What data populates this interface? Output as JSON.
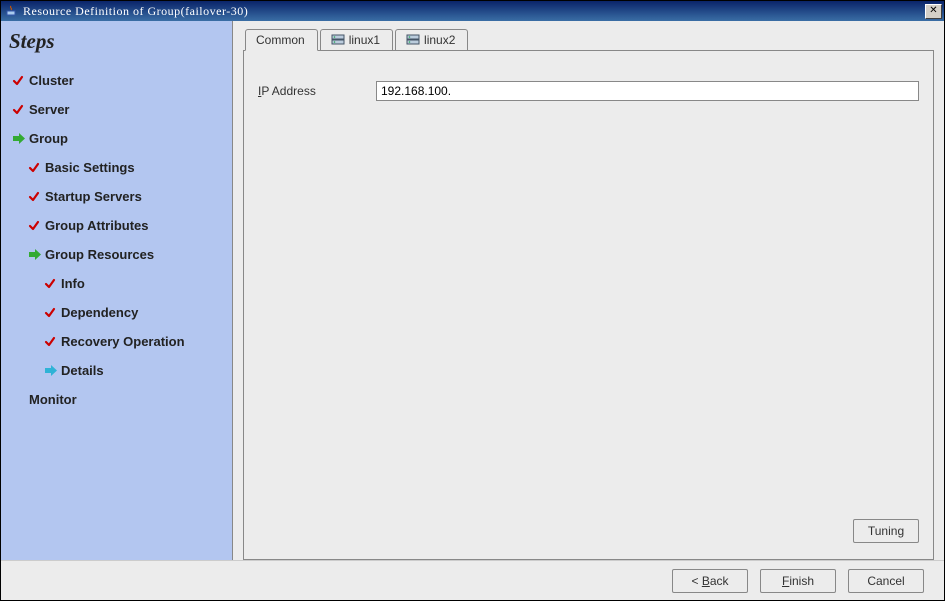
{
  "titlebar": {
    "text": "Resource Definition of Group(failover-30)"
  },
  "sidebar": {
    "title": "Steps",
    "items": [
      {
        "icon": "check",
        "label": "Cluster",
        "level": 0
      },
      {
        "icon": "check",
        "label": "Server",
        "level": 0
      },
      {
        "icon": "arrow-green",
        "label": "Group",
        "level": 0
      },
      {
        "icon": "check",
        "label": "Basic Settings",
        "level": 1
      },
      {
        "icon": "check",
        "label": "Startup Servers",
        "level": 1
      },
      {
        "icon": "check",
        "label": "Group Attributes",
        "level": 1
      },
      {
        "icon": "arrow-green",
        "label": "Group Resources",
        "level": 1
      },
      {
        "icon": "check",
        "label": "Info",
        "level": 2
      },
      {
        "icon": "check",
        "label": "Dependency",
        "level": 2
      },
      {
        "icon": "check",
        "label": "Recovery Operation",
        "level": 2
      },
      {
        "icon": "arrow-blue",
        "label": "Details",
        "level": 2
      },
      {
        "icon": "none",
        "label": "Monitor",
        "level": 0
      }
    ]
  },
  "tabs": [
    {
      "label": "Common",
      "icon": "none",
      "active": true
    },
    {
      "label": "linux1",
      "icon": "server",
      "active": false
    },
    {
      "label": "linux2",
      "icon": "server",
      "active": false
    }
  ],
  "form": {
    "ip_label_prefix": "I",
    "ip_label_rest": "P Address",
    "ip_value": "192.168.100."
  },
  "buttons": {
    "tuning": "Tuning",
    "back_prefix": "< ",
    "back_ul": "B",
    "back_rest": "ack",
    "finish_ul": "F",
    "finish_rest": "inish",
    "cancel": "Cancel"
  }
}
